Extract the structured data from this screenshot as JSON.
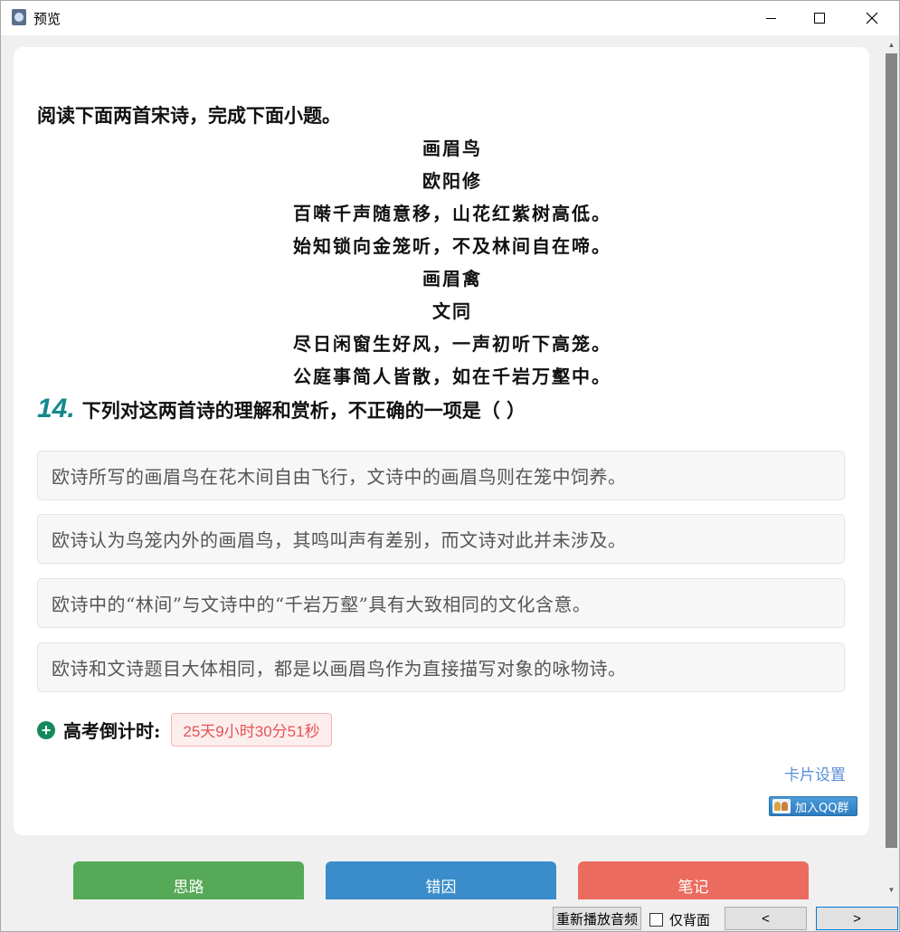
{
  "window": {
    "title": "预览"
  },
  "intro": "阅读下面两首宋诗，完成下面小题。",
  "poems": [
    "画眉鸟",
    "欧阳修",
    "百啭千声随意移，山花红紫树高低。",
    "始知锁向金笼听，不及林间自在啼。",
    "画眉禽",
    "文同",
    "尽日闲窗生好风，一声初听下高笼。",
    "公庭事简人皆散，如在千岩万壑中。"
  ],
  "question": {
    "number": "14.",
    "text": "下列对这两首诗的理解和赏析，不正确的一项是（ ）",
    "options": [
      "欧诗所写的画眉鸟在花木间自由飞行，文诗中的画眉鸟则在笼中饲养。",
      "欧诗认为鸟笼内外的画眉鸟，其鸣叫声有差别，而文诗对此并未涉及。",
      "欧诗中的“林间”与文诗中的“千岩万壑”具有大致相同的文化含意。",
      "欧诗和文诗题目大体相同，都是以画眉鸟作为直接描写对象的咏物诗。"
    ]
  },
  "countdown": {
    "label": "高考倒计时:",
    "value": "25天9小时30分51秒"
  },
  "card_settings": "卡片设置",
  "qq_group": "加入QQ群",
  "actions": {
    "thinking": "思路",
    "error_cause": "错因",
    "note": "笔记"
  },
  "bottombar": {
    "replay_audio": "重新播放音频",
    "back_only": "仅背面",
    "prev": "<",
    "next": ">"
  },
  "colors": {
    "question_number": "#15898c",
    "thinking": "#56a957",
    "error_cause": "#3a8dca",
    "note": "#ec6b5f",
    "countdown_text": "#e45454",
    "link": "#5b8fd6"
  },
  "icons": {
    "app": "app-icon",
    "plus": "plus-circle-icon",
    "qq": "qq-group-icon"
  }
}
